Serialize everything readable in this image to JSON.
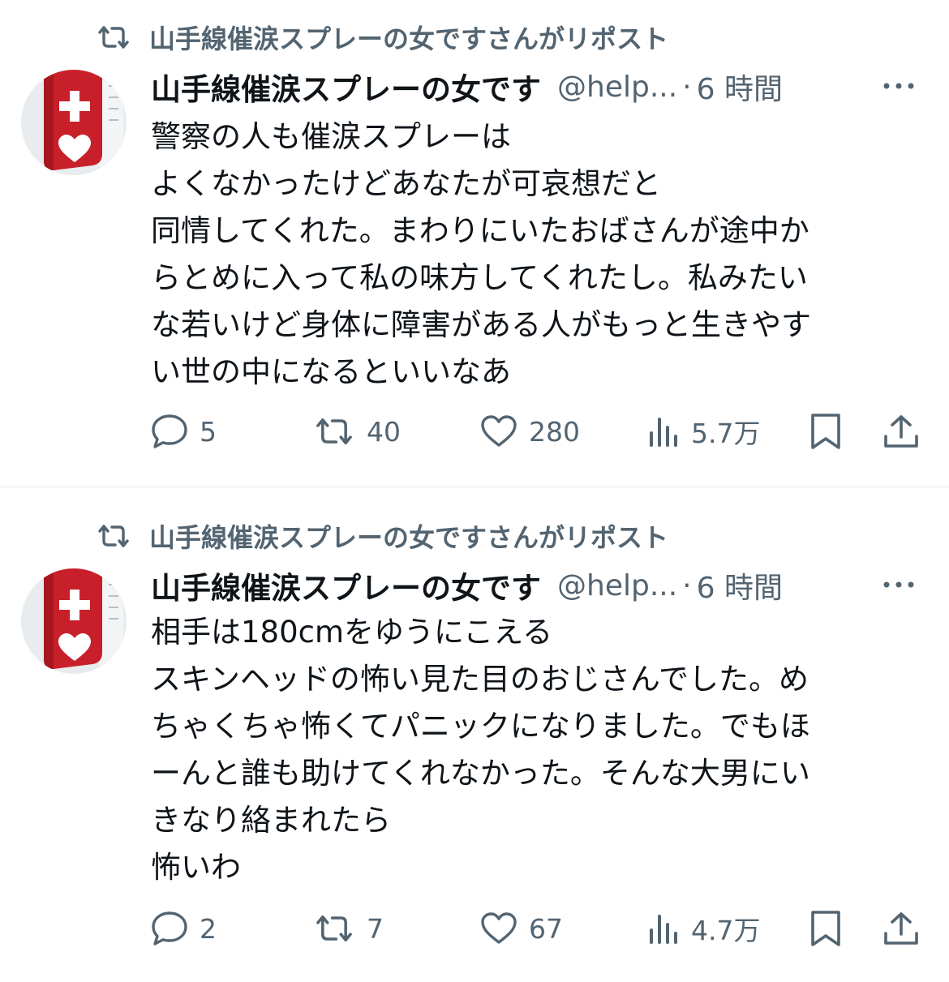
{
  "colors": {
    "text": "#0f1419",
    "muted": "#536471",
    "divider": "#e3e6e8",
    "avatar_red": "#c8202a"
  },
  "tweets": [
    {
      "repost_label": "山手線催涙スプレーの女ですさんがリポスト",
      "name": "山手線催涙スプレーの女です",
      "handle": "@help...",
      "dot": "·",
      "time": "6 時間",
      "lines": [
        "警察の人も催涙スプレーは",
        "よくなかったけどあなたが可哀想だと",
        "同情してくれた。まわりにいたおばさんが途中か",
        "らとめに入って私の味方してくれたし。私みたい",
        "な若いけど身体に障害がある人がもっと生きやす",
        "い世の中になるといいなあ"
      ],
      "counts": {
        "replies": "5",
        "reposts": "40",
        "likes": "280",
        "views": "5.7万"
      }
    },
    {
      "repost_label": "山手線催涙スプレーの女ですさんがリポスト",
      "name": "山手線催涙スプレーの女です",
      "handle": "@help...",
      "dot": "·",
      "time": "6 時間",
      "lines": [
        "相手は180cmをゆうにこえる",
        "スキンヘッドの怖い見た目のおじさんでした。め",
        "ちゃくちゃ怖くてパニックになりました。でもほ",
        "ーんと誰も助けてくれなかった。そんな大男にい",
        "きなり絡まれたら",
        "怖いわ"
      ],
      "counts": {
        "replies": "2",
        "reposts": "7",
        "likes": "67",
        "views": "4.7万"
      }
    }
  ],
  "icons": [
    "repost-icon",
    "more-icon",
    "reply-icon",
    "like-icon",
    "views-icon",
    "bookmark-icon",
    "share-icon",
    "avatar-cross-icon",
    "avatar-heart-icon"
  ]
}
